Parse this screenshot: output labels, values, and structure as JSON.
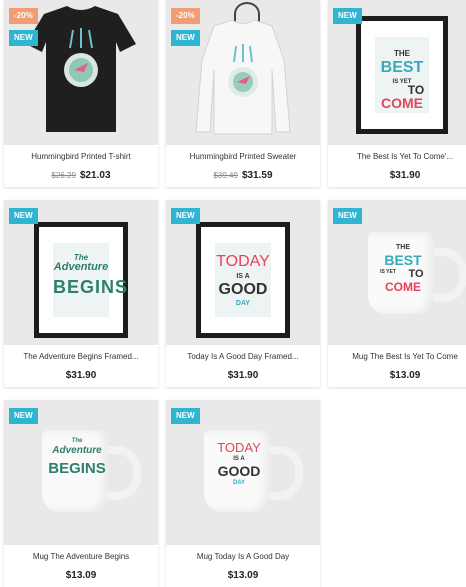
{
  "colors": {
    "new_badge": "#2fb5d2",
    "discount_badge": "#f39d72",
    "card_bg": "#e9e9e9",
    "price_text": "#232323"
  },
  "products": [
    {
      "name": "Hummingbird Printed T-shirt",
      "old_price": "$26.29",
      "price": "$21.03",
      "discount": "-20%",
      "badge": "NEW",
      "image": "black-tshirt-hummingbird"
    },
    {
      "name": "Hummingbird Printed Sweater",
      "old_price": "$39.49",
      "price": "$31.59",
      "discount": "-20%",
      "badge": "NEW",
      "image": "white-sweater-hummingbird"
    },
    {
      "name": "The Best Is Yet To Come'...",
      "price": "$31.90",
      "badge": "NEW",
      "image": "framed-poster-best",
      "art": [
        "THE",
        "BEST",
        "IS YET",
        "TO",
        "COME"
      ]
    },
    {
      "name": "The Adventure Begins Framed...",
      "price": "$31.90",
      "badge": "NEW",
      "image": "framed-poster-adventure",
      "art": [
        "The",
        "Adventure",
        "BEGINS"
      ]
    },
    {
      "name": "Today Is A Good Day Framed...",
      "price": "$31.90",
      "badge": "NEW",
      "image": "framed-poster-today",
      "art": [
        "TODAY",
        "IS A",
        "GOOD",
        "DAY"
      ]
    },
    {
      "name": "Mug The Best Is Yet To Come",
      "price": "$13.09",
      "badge": "NEW",
      "image": "mug-best",
      "art": [
        "THE",
        "BEST",
        "IS YET",
        "TO",
        "COME"
      ]
    },
    {
      "name": "Mug The Adventure Begins",
      "price": "$13.09",
      "badge": "NEW",
      "image": "mug-adventure",
      "art": [
        "The",
        "Adventure",
        "BEGINS"
      ]
    },
    {
      "name": "Mug Today Is A Good Day",
      "price": "$13.09",
      "badge": "NEW",
      "image": "mug-today",
      "art": [
        "TODAY",
        "IS A",
        "GOOD",
        "DAY"
      ]
    }
  ]
}
